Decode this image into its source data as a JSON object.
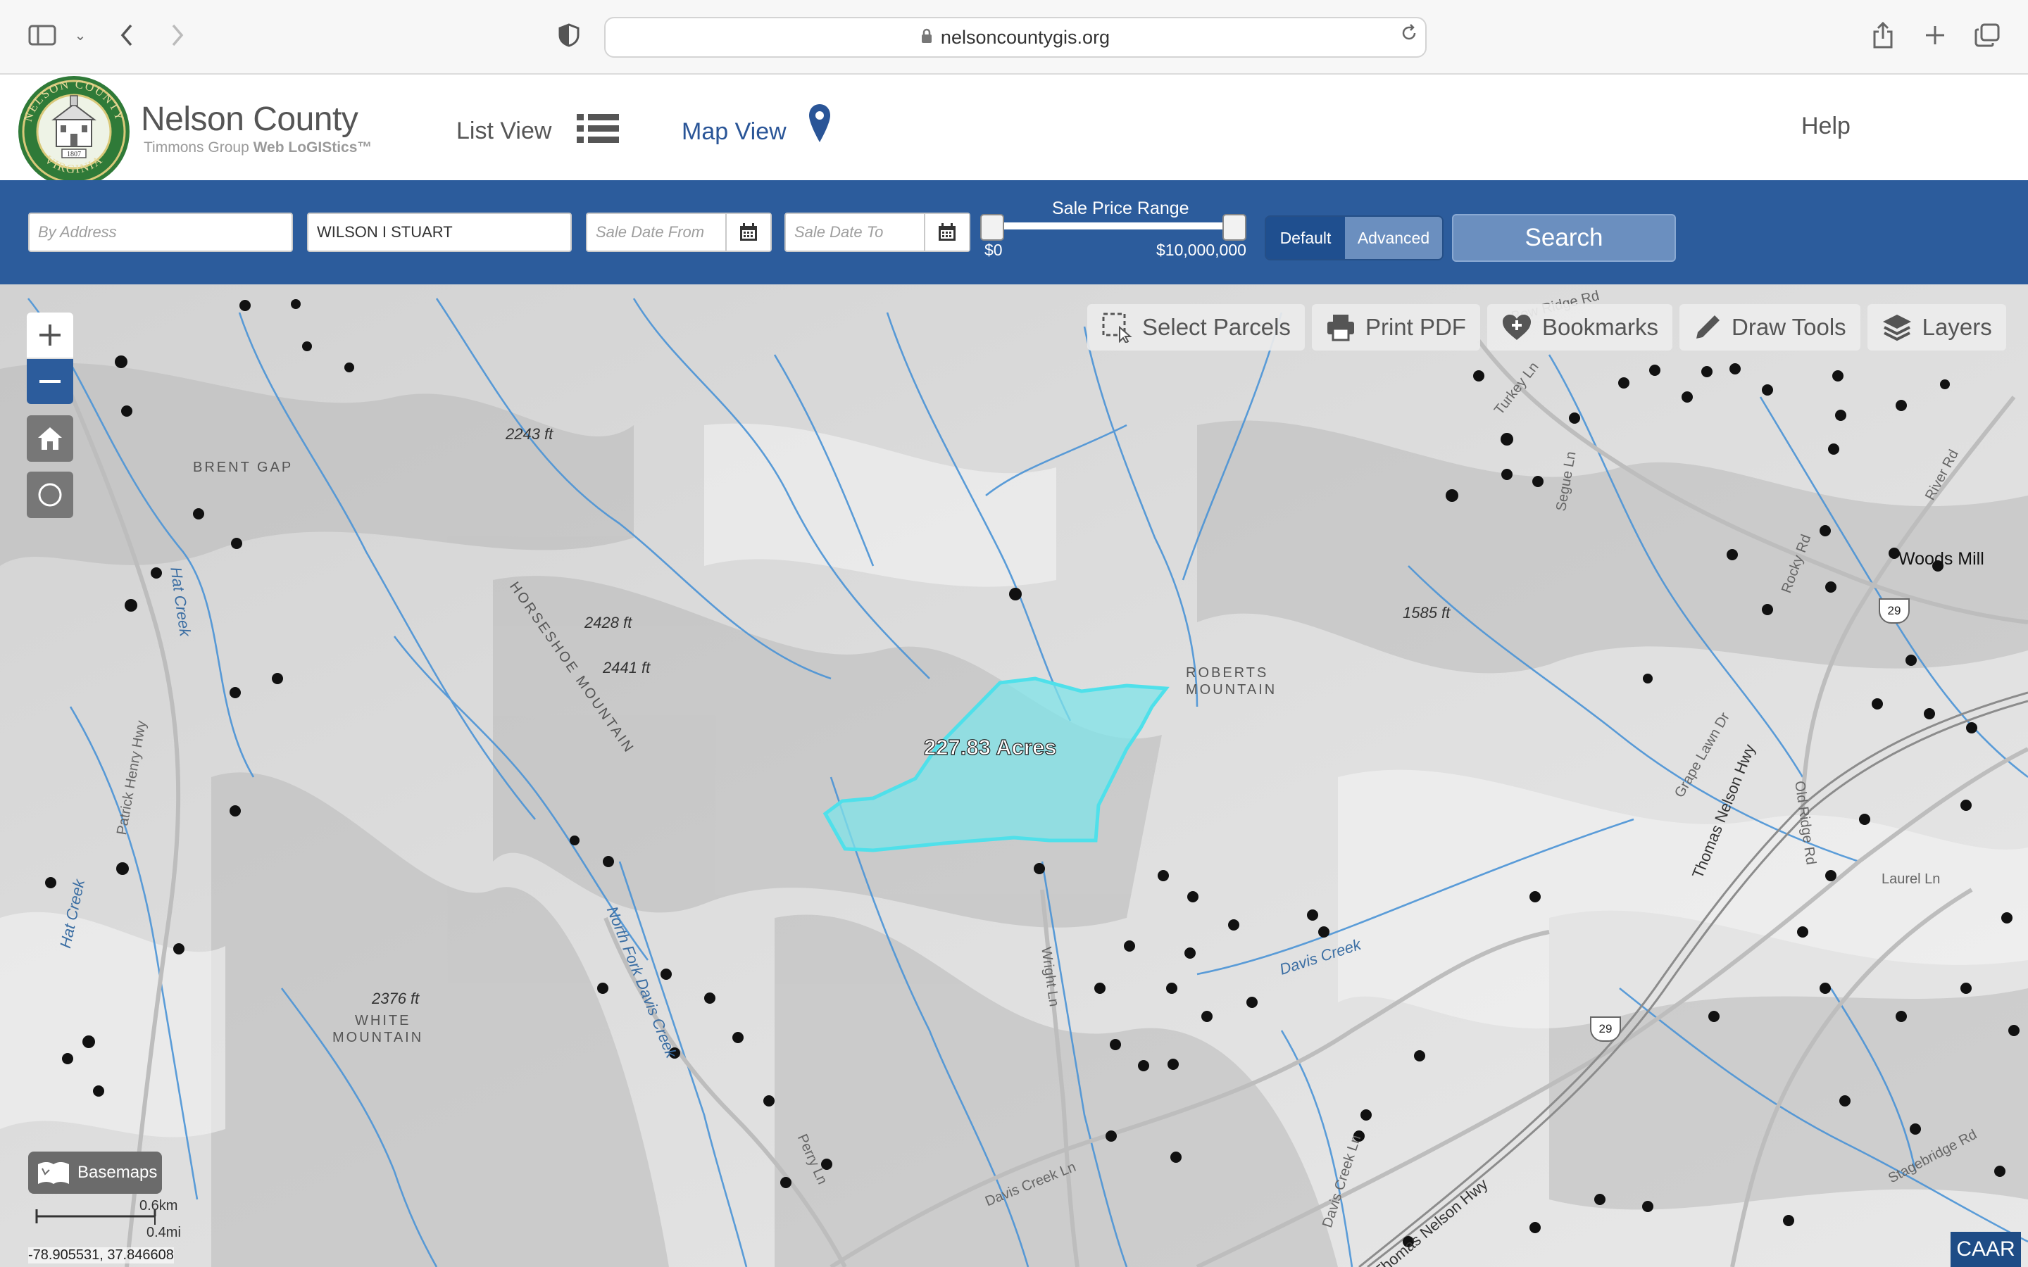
{
  "browser": {
    "url": "nelsoncountygis.org"
  },
  "header": {
    "title": "Nelson County",
    "subtitle_prefix": "Timmons Group",
    "subtitle_product": "Web LoGIStics™",
    "seal_text_top": "NELSON COUNTY",
    "seal_text_bottom": "VIRGINIA",
    "seal_year": "1807",
    "nav": {
      "list_view": "List View",
      "map_view": "Map View",
      "help": "Help"
    }
  },
  "search": {
    "address_placeholder": "By Address",
    "owner_value": "WILSON I STUART",
    "sale_date_from_placeholder": "Sale Date From",
    "sale_date_to_placeholder": "Sale Date To",
    "sale_price_label": "Sale Price Range",
    "sale_price_min": "$0",
    "sale_price_max": "$10,000,000",
    "mode_default": "Default",
    "mode_advanced": "Advanced",
    "search_label": "Search"
  },
  "map": {
    "toolbar": {
      "select_parcels": "Select Parcels",
      "print_pdf": "Print PDF",
      "bookmarks": "Bookmarks",
      "draw_tools": "Draw Tools",
      "layers": "Layers"
    },
    "parcel_label": "227.83 Acres",
    "labels": {
      "brent_gap": "BRENT GAP",
      "horseshoe_mountain": "HORSESHOE MOUNTAIN",
      "roberts_mountain_1": "ROBERTS",
      "roberts_mountain_2": "MOUNTAIN",
      "white_mountain_1": "WHITE",
      "white_mountain_2": "MOUNTAIN",
      "woods_mill": "Woods Mill",
      "elev_2243": "2243 ft",
      "elev_2428": "2428 ft",
      "elev_2441": "2441 ft",
      "elev_1585": "1585 ft",
      "elev_2376": "2376 ft",
      "hat_creek_1": "Hat Creek",
      "hat_creek_2": "Hat Creek",
      "patrick_henry": "Patrick Henry Hwy",
      "north_fork": "North Fork Davis Creek",
      "davis_creek": "Davis Creek",
      "davis_creek_ln_1": "Davis Creek Ln",
      "davis_creek_ln_2": "Davis Creek Ln",
      "wright_ln": "Wright Ln",
      "perry_ln": "Perry Ln",
      "thomas_nelson_1": "Thomas Nelson Hwy",
      "thomas_nelson_2": "Thomas Nelson Hwy",
      "grape_lawn": "Grape Lawn Dr",
      "old_ridge": "Old Ridge Rd",
      "laurel_ln": "Laurel Ln",
      "stagebridge": "Stagebridge Rd",
      "rocky_rd": "Rocky Rd",
      "river_rd": "River Rd",
      "segue_ln": "Segue Ln",
      "turkey_ln": "Turkey Ln",
      "bow_ridge": "Bow Ridge Rd",
      "route_29_a": "29",
      "route_29_b": "29"
    },
    "basemaps_label": "Basemaps",
    "scale_km": "0.6km",
    "scale_mi": "0.4mi",
    "coordinates": "-78.905531, 37.846608",
    "caar_logo": "CAAR"
  },
  "colors": {
    "brand_blue": "#2c5c9c",
    "parcel_fill": "#7fe3e8",
    "parcel_stroke": "#4fe0ea",
    "stream": "#4a93d6"
  }
}
